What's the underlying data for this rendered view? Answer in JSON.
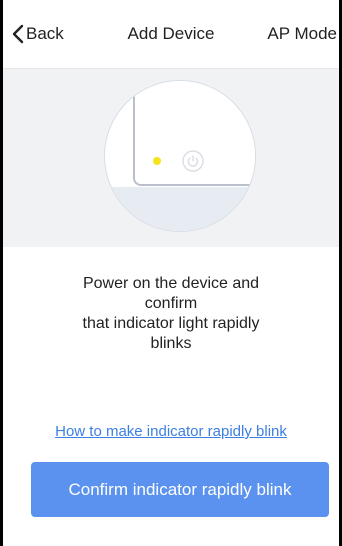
{
  "header": {
    "back_label": "Back",
    "title": "Add Device",
    "ap_mode_label": "AP Mode"
  },
  "icons": {
    "back": "chevron-left-icon",
    "power": "power-icon",
    "indicator": "indicator-light"
  },
  "instruction": {
    "lines": [
      "Power on the device and",
      "confirm",
      "that indicator light rapidly",
      "blinks"
    ]
  },
  "help_link": "How to make indicator rapidly blink",
  "confirm_button": "Confirm indicator rapidly blink",
  "colors": {
    "accent": "#5b92ef",
    "link": "#3c7fe2",
    "indicator": "#f6e21f",
    "panel_background": "#f1f2f4"
  }
}
